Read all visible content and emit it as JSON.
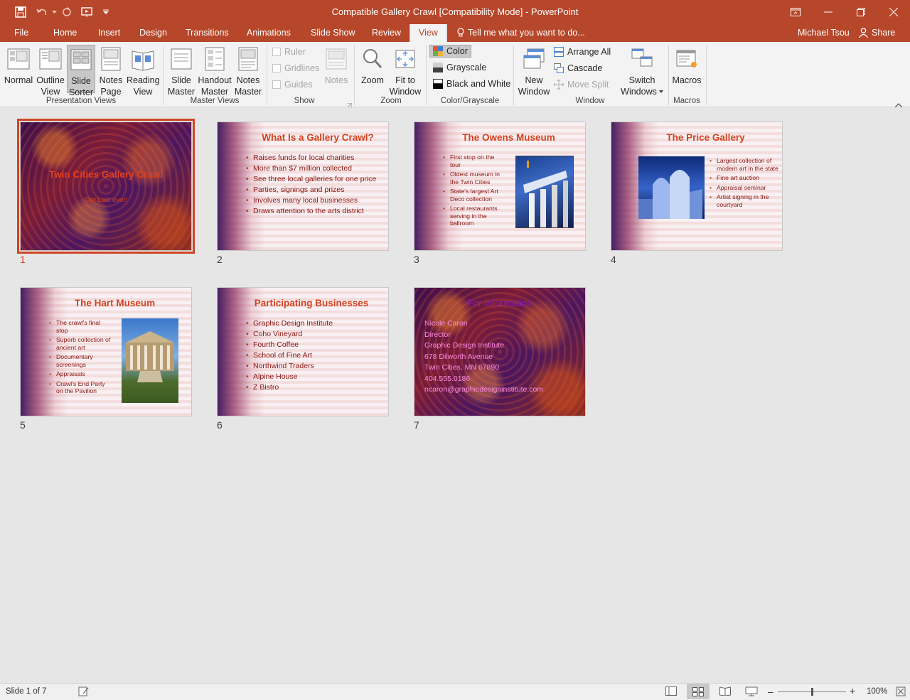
{
  "window": {
    "title": "Compatible Gallery Crawl [Compatibility Mode] - PowerPoint",
    "user": "Michael Tsou",
    "share_label": "Share"
  },
  "tabs": {
    "file": "File",
    "home": "Home",
    "insert": "Insert",
    "design": "Design",
    "transitions": "Transitions",
    "animations": "Animations",
    "slideshow": "Slide Show",
    "review": "Review",
    "view": "View",
    "tellme": "Tell me what you want to do..."
  },
  "ribbon": {
    "presentation_views": {
      "group": "Presentation Views",
      "normal": "Normal",
      "outline": [
        "Outline",
        "View"
      ],
      "sorter": [
        "Slide",
        "Sorter"
      ],
      "notes": [
        "Notes",
        "Page"
      ],
      "reading": [
        "Reading",
        "View"
      ]
    },
    "master_views": {
      "group": "Master Views",
      "slide": [
        "Slide",
        "Master"
      ],
      "handout": [
        "Handout",
        "Master"
      ],
      "notes": [
        "Notes",
        "Master"
      ]
    },
    "show": {
      "group": "Show",
      "ruler": "Ruler",
      "gridlines": "Gridlines",
      "guides": "Guides",
      "notes": "Notes"
    },
    "zoom": {
      "group": "Zoom",
      "zoom": "Zoom",
      "fit": [
        "Fit to",
        "Window"
      ]
    },
    "color": {
      "group": "Color/Grayscale",
      "color": "Color",
      "grayscale": "Grayscale",
      "bw": "Black and White"
    },
    "window": {
      "group": "Window",
      "new": [
        "New",
        "Window"
      ],
      "arrange": "Arrange All",
      "cascade": "Cascade",
      "movesplit": "Move Split",
      "switch": [
        "Switch",
        "Windows"
      ]
    },
    "macros": {
      "group": "Macros",
      "macros": "Macros"
    }
  },
  "slides": [
    {
      "number": "1",
      "title": "Twin Cities Gallery Crawl",
      "subtitle": "Our Last ever!"
    },
    {
      "number": "2",
      "title": "What Is a Gallery Crawl?",
      "bullets": [
        "Raises funds for local charities",
        "More than $7 million collected",
        "See three local galleries for one price",
        "Parties, signings and prizes",
        "Involves many local businesses",
        "Draws attention to the arts district"
      ]
    },
    {
      "number": "3",
      "title": "The Owens Museum",
      "bullets": [
        "First stop on the tour",
        "Oldest museum in the Twin Cities",
        "State's largest Art Deco collection",
        "Local restaurants serving in the ballroom"
      ]
    },
    {
      "number": "4",
      "title": "The Price Gallery",
      "bullets": [
        "Largest collection of modern art in the state",
        "Fine art auction",
        "Appraisal seminar",
        "Artist signing in the courtyard"
      ]
    },
    {
      "number": "5",
      "title": "The Hart Museum",
      "bullets": [
        "The crawl's final stop",
        "Superb collection of ancient art",
        "Documentary screenings",
        "Appraisals",
        "Crawl's End Party on the Pavilion"
      ]
    },
    {
      "number": "6",
      "title": "Participating Businesses",
      "bullets": [
        "Graphic Design Institute",
        "Coho Vineyard",
        "Fourth Coffee",
        "School of Fine Art",
        "Northwind Traders",
        "Alpine House",
        "Z Bistro"
      ]
    },
    {
      "number": "7",
      "title": "For Information",
      "lines": [
        "Nicole Caron",
        "Director",
        "Graphic Design Institute",
        "678 Dilworth Avenue",
        "Twin Cities, MN 67890",
        "404.555.0186",
        "ncaron@graphicdesigninstitute.com"
      ]
    }
  ],
  "status": {
    "slide_info": "Slide 1 of 7",
    "zoom": "100%",
    "zoom_fraction": 0.5
  },
  "colors": {
    "accent": "#b7472a",
    "title_red": "#d3421f",
    "bullet_red": "#8b1410"
  }
}
